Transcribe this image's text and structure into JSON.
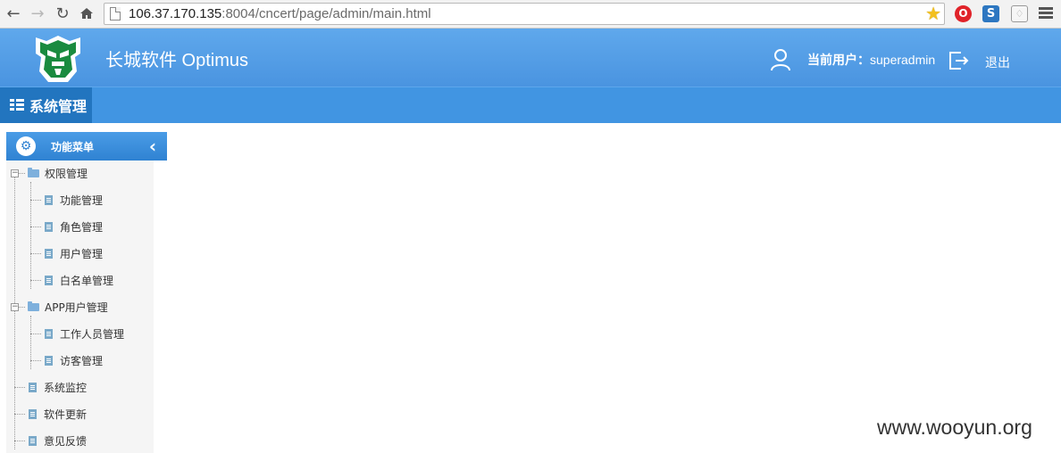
{
  "browser": {
    "back_icon": "back-arrow-icon",
    "forward_icon": "forward-arrow-icon",
    "reload_icon": "reload-icon",
    "home_icon": "home-icon",
    "url_host": "106.37.170.135",
    "url_rest": ":8004/cncert/page/admin/main.html",
    "star_icon": "bookmark-star-icon",
    "extensions": [
      "opera-icon",
      "s-extension-icon",
      "shield-extension-icon"
    ]
  },
  "header": {
    "title": "长城软件 Optimus",
    "user_prefix": "当前用户：",
    "username": "superadmin",
    "logout_label": "退出",
    "bg_color": "#4a94e0"
  },
  "module_nav": {
    "active_tab": "系统管理"
  },
  "sidebar": {
    "title": "功能菜单",
    "groups": [
      {
        "label": "权限管理",
        "expanded": true,
        "children": [
          "功能管理",
          "角色管理",
          "用户管理",
          "白名单管理"
        ]
      },
      {
        "label": "APP用户管理",
        "expanded": true,
        "children": [
          "工作人员管理",
          "访客管理"
        ]
      }
    ],
    "items": [
      "系统监控",
      "软件更新",
      "意见反馈"
    ]
  },
  "watermark": "www.wooyun.org"
}
